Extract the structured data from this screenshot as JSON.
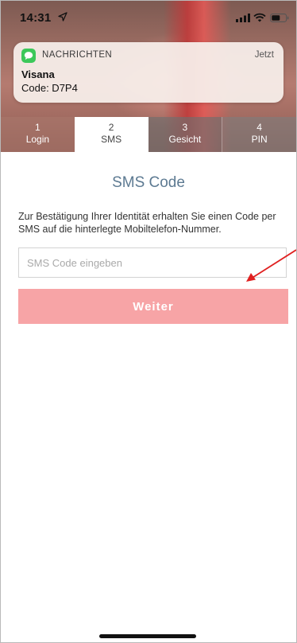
{
  "status_bar": {
    "time": "14:31",
    "icons": [
      "location-arrow-icon",
      "cellular-signal-icon",
      "wifi-icon",
      "battery-icon"
    ]
  },
  "notification": {
    "app_name": "NACHRICHTEN",
    "time": "Jetzt",
    "sender": "Visana",
    "message": "Code: D7P4",
    "icon": "messages-app-icon",
    "icon_color": "#3cc85a"
  },
  "steps": [
    {
      "number": "1",
      "label": "Login"
    },
    {
      "number": "2",
      "label": "SMS"
    },
    {
      "number": "3",
      "label": "Gesicht"
    },
    {
      "number": "4",
      "label": "PIN"
    }
  ],
  "active_step": "2",
  "page": {
    "title": "SMS Code",
    "description": "Zur Bestätigung Ihrer Identität erhalten Sie einen Code per SMS auf die hinterlegte Mobiltelefon-Nummer.",
    "input_placeholder": "SMS Code eingeben",
    "input_value": "",
    "button_label": "Weiter"
  },
  "colors": {
    "title": "#5d7a92",
    "button": "#f7a4a6",
    "annotation_arrow": "#e02020"
  }
}
